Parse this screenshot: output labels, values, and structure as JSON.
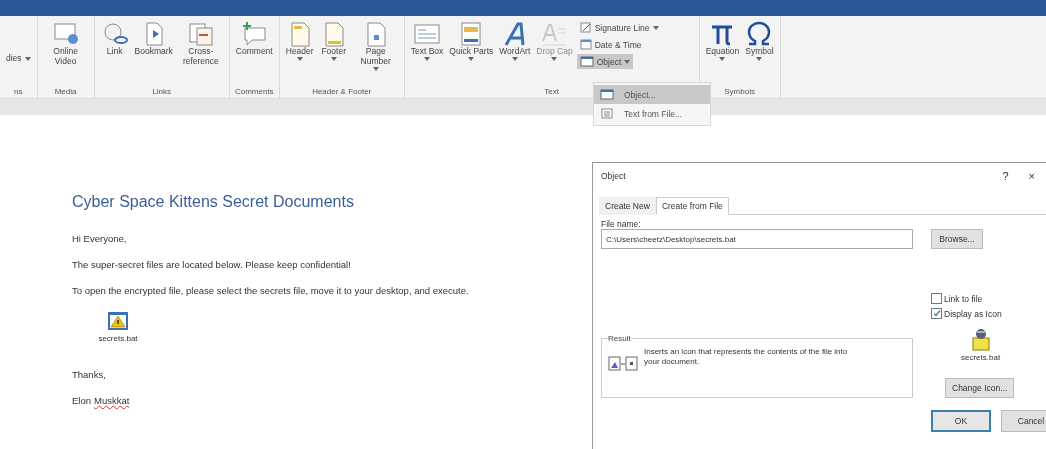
{
  "ribbon": {
    "groups": [
      {
        "label": "ns",
        "items": [
          {
            "label": "dies",
            "kind": "partial",
            "dropdown": true,
            "disabled": false
          }
        ]
      },
      {
        "label": "Media",
        "items": [
          {
            "label": "Online Video",
            "kind": "video",
            "dropdown": false,
            "disabled": false
          }
        ]
      },
      {
        "label": "Links",
        "items": [
          {
            "label": "Link",
            "kind": "link",
            "dropdown": false,
            "disabled": false
          },
          {
            "label": "Bookmark",
            "kind": "bookmark",
            "dropdown": false,
            "disabled": false
          },
          {
            "label": "Cross-reference",
            "kind": "crossref",
            "dropdown": false,
            "disabled": false
          }
        ]
      },
      {
        "label": "Comments",
        "items": [
          {
            "label": "Comment",
            "kind": "comment",
            "dropdown": false,
            "disabled": false
          }
        ]
      },
      {
        "label": "Header & Footer",
        "items": [
          {
            "label": "Header",
            "kind": "header",
            "dropdown": true,
            "disabled": false
          },
          {
            "label": "Footer",
            "kind": "footer",
            "dropdown": true,
            "disabled": false
          },
          {
            "label": "Page Number",
            "kind": "pagenum",
            "dropdown": true,
            "disabled": false
          }
        ]
      },
      {
        "label": "Text",
        "items": [
          {
            "label": "Text Box",
            "kind": "textbox",
            "dropdown": true,
            "disabled": false
          },
          {
            "label": "Quick Parts",
            "kind": "quickparts",
            "dropdown": true,
            "disabled": false
          },
          {
            "label": "WordArt",
            "kind": "wordart",
            "dropdown": true,
            "disabled": false
          },
          {
            "label": "Drop Cap",
            "kind": "dropcap",
            "dropdown": true,
            "disabled": true
          }
        ],
        "small_items": [
          {
            "label": "Signature Line",
            "kind": "signature",
            "dropdown": true,
            "expanded": false
          },
          {
            "label": "Date & Time",
            "kind": "datetime",
            "dropdown": false,
            "expanded": false
          },
          {
            "label": "Object",
            "kind": "object",
            "dropdown": true,
            "expanded": true
          }
        ]
      },
      {
        "label": "Symbols",
        "items": [
          {
            "label": "Equation",
            "kind": "pi",
            "dropdown": true,
            "disabled": false
          },
          {
            "label": "Symbol",
            "kind": "omega",
            "dropdown": true,
            "disabled": false
          }
        ]
      }
    ]
  },
  "object_menu": [
    {
      "label": "Object...",
      "kind": "object",
      "selected": true
    },
    {
      "label": "Text from File...",
      "kind": "textfile",
      "selected": false
    }
  ],
  "document": {
    "title": "Cyber Space Kittens Secret Documents",
    "paragraphs": [
      "Hi Everyone,",
      "The super-secret files are located below.  Please keep confidential!",
      "To open the encrypted file, please select the secrets file, move it to your desktop, and execute."
    ],
    "attachment": {
      "caption": "secrets.bat"
    },
    "closing": "Thanks,",
    "signature": [
      {
        "text": "Elon",
        "misspelled": false
      },
      {
        "text": "Muskkat",
        "misspelled": true
      }
    ]
  },
  "dialog": {
    "title": "Object",
    "help": "?",
    "close": "×",
    "tabs": [
      {
        "label": "Create New",
        "selected": false
      },
      {
        "label": "Create from File",
        "selected": true
      }
    ],
    "file_name_label": "File name:",
    "file_name": "C:\\Users\\cheetz\\Desktop\\secrets.bat",
    "browse": "Browse...",
    "checkboxes": [
      {
        "label": "Link to file",
        "checked": false
      },
      {
        "label": "Display as Icon",
        "checked": true
      }
    ],
    "result": {
      "label": "Result",
      "text": "Inserts an icon that represents the contents of the file into your document."
    },
    "icon_caption": "secrets.bat",
    "change_icon": "Change Icon...",
    "buttons": [
      {
        "label": "OK",
        "default": true
      },
      {
        "label": "Cancel",
        "default": false
      }
    ]
  }
}
